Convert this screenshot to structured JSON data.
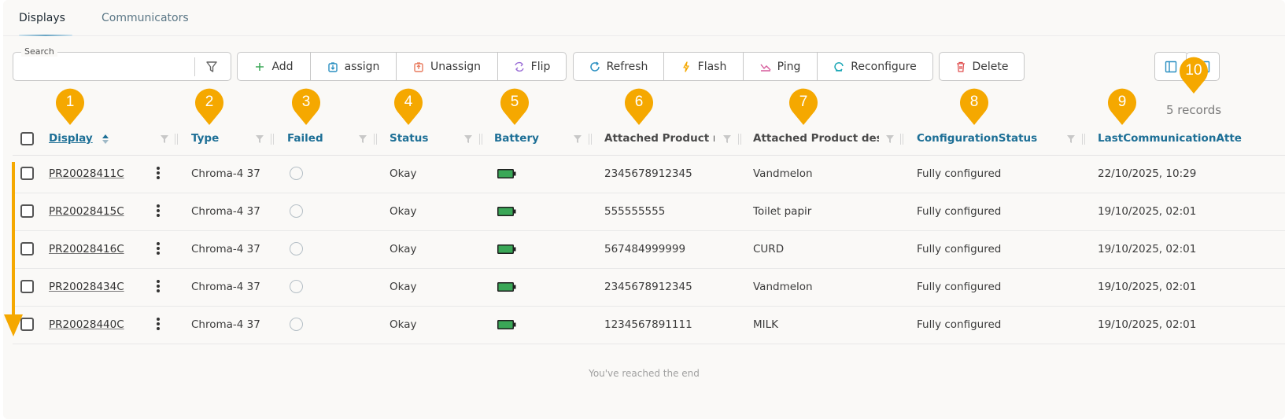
{
  "tabs": [
    {
      "label": "Displays",
      "active": true
    },
    {
      "label": "Communicators",
      "active": false
    }
  ],
  "search": {
    "legend": "Search",
    "value": "",
    "placeholder": ""
  },
  "toolbar": {
    "group1": [
      {
        "label": "Add",
        "icon": "plus-icon"
      },
      {
        "label": "assign",
        "icon": "assign-icon"
      },
      {
        "label": "Unassign",
        "icon": "unassign-icon"
      },
      {
        "label": "Flip",
        "icon": "flip-icon"
      }
    ],
    "group2": [
      {
        "label": "Refresh",
        "icon": "refresh-icon"
      },
      {
        "label": "Flash",
        "icon": "flash-icon"
      },
      {
        "label": "Ping",
        "icon": "ping-icon"
      },
      {
        "label": "Reconfigure",
        "icon": "reconfigure-icon"
      }
    ],
    "delete_label": "Delete"
  },
  "records_label": "5 records",
  "columns": {
    "display": "Display",
    "type": "Type",
    "failed": "Failed",
    "status": "Status",
    "battery": "Battery",
    "attached_nr": "Attached Product nr",
    "attached_desc": "Attached Product desc",
    "config_status": "ConfigurationStatus",
    "last_comm": "LastCommunicationAtte"
  },
  "rows": [
    {
      "display": "PR20028411C",
      "type": "Chroma-4 37",
      "status": "Okay",
      "attached_nr": "2345678912345",
      "attached_desc": "Vandmelon",
      "config_status": "Fully configured",
      "last_comm": "22/10/2025, 10:29"
    },
    {
      "display": "PR20028415C",
      "type": "Chroma-4 37",
      "status": "Okay",
      "attached_nr": "555555555",
      "attached_desc": "Toilet papir",
      "config_status": "Fully configured",
      "last_comm": "19/10/2025, 02:01"
    },
    {
      "display": "PR20028416C",
      "type": "Chroma-4 37",
      "status": "Okay",
      "attached_nr": "567484999999",
      "attached_desc": "CURD",
      "config_status": "Fully configured",
      "last_comm": "19/10/2025, 02:01"
    },
    {
      "display": "PR20028434C",
      "type": "Chroma-4 37",
      "status": "Okay",
      "attached_nr": "2345678912345",
      "attached_desc": "Vandmelon",
      "config_status": "Fully configured",
      "last_comm": "19/10/2025, 02:01"
    },
    {
      "display": "PR20028440C",
      "type": "Chroma-4 37",
      "status": "Okay",
      "attached_nr": "1234567891111",
      "attached_desc": "MILK",
      "config_status": "Fully configured",
      "last_comm": "19/10/2025, 02:01"
    }
  ],
  "end_text": "You've reached the end",
  "annotations": [
    "1",
    "2",
    "3",
    "4",
    "5",
    "6",
    "7",
    "8",
    "9",
    "10"
  ],
  "colors": {
    "accent": "#1d6f96",
    "badge": "#f5a800",
    "battery": "#3aa757"
  }
}
